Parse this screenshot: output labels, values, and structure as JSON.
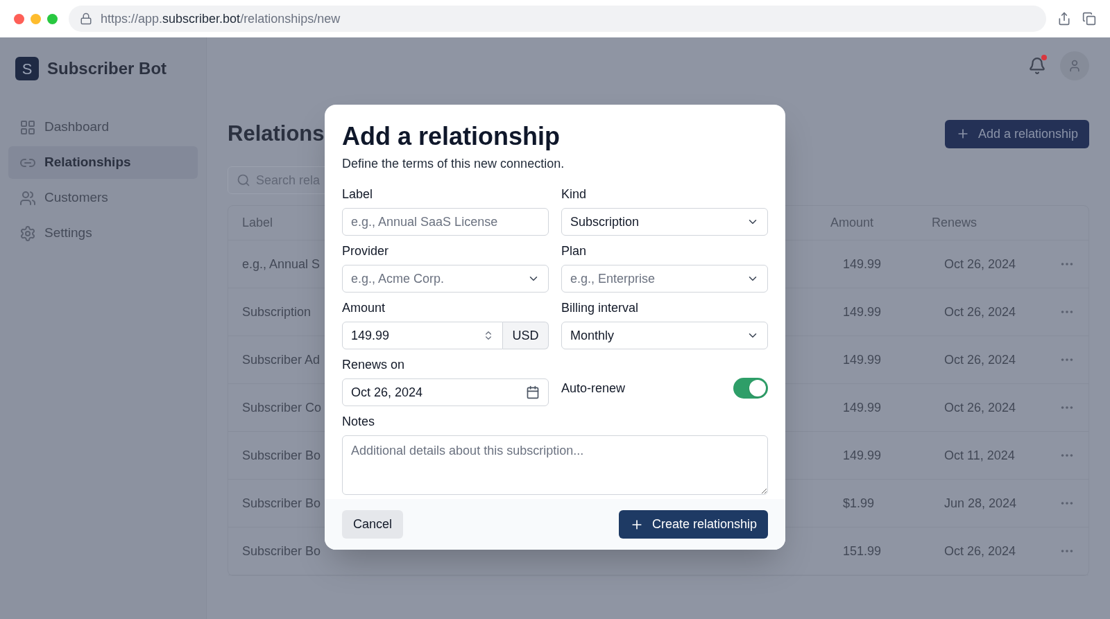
{
  "browser": {
    "url": [
      {
        "text": "https://app.",
        "strong": false
      },
      {
        "text": "subscriber.bot",
        "strong": true
      },
      {
        "text": "/relationships/new",
        "strong": false
      }
    ]
  },
  "app": {
    "logo_letter": "S",
    "name": "Subscriber Bot"
  },
  "sidebar": {
    "items": [
      {
        "label": "Dashboard",
        "selected": false
      },
      {
        "label": "Relationships",
        "selected": true
      },
      {
        "label": "Customers",
        "selected": false
      },
      {
        "label": "Settings",
        "selected": false
      }
    ]
  },
  "header": {
    "notification_unread": true
  },
  "page": {
    "title": "Relations",
    "add_button": "Add a relationship",
    "search": {
      "placeholder": "Search rela"
    }
  },
  "table": {
    "columns": {
      "label": "Label",
      "amount": "Amount",
      "renews": "Renews"
    },
    "rows": [
      {
        "label": "e.g., Annual S",
        "amount": "149.99",
        "renews": "Oct 26, 2024"
      },
      {
        "label": "Subscription",
        "amount": "149.99",
        "renews": "Oct 26, 2024"
      },
      {
        "label": "Subscriber Ad",
        "amount": "149.99",
        "renews": "Oct 26, 2024"
      },
      {
        "label": "Subscriber Co",
        "amount": "149.99",
        "renews": "Oct 26, 2024"
      },
      {
        "label": "Subscriber Bo",
        "amount": "149.99",
        "renews": "Oct 11, 2024"
      },
      {
        "label": "Subscriber Bo",
        "amount": "$1.99",
        "renews": "Jun 28, 2024"
      },
      {
        "label": "Subscriber Bo",
        "amount": "151.99",
        "renews": "Oct 26, 2024"
      }
    ]
  },
  "dialog": {
    "title": "Add a relationship",
    "subtitle": "Define the terms of this new connection.",
    "fields": [
      {
        "kind": "text",
        "label": "Label",
        "placeholder": "e.g., Annual SaaS License"
      },
      {
        "kind": "select",
        "label": "Kind",
        "value": "Subscription"
      },
      {
        "kind": "select",
        "label": "Provider",
        "placeholder": "e.g., Acme Corp."
      },
      {
        "kind": "select",
        "label": "Plan",
        "placeholder": "e.g., Enterprise"
      },
      {
        "kind": "amount",
        "label": "Amount",
        "value": "149.99",
        "currency": "USD"
      },
      {
        "kind": "select",
        "label": "Billing interval",
        "value": "Monthly"
      },
      {
        "kind": "date",
        "label": "Renews on",
        "value": "Oct 26, 2024"
      },
      {
        "kind": "toggle",
        "label": "Auto-renew",
        "on": true
      },
      {
        "kind": "textarea",
        "label": "Notes",
        "placeholder": "Additional details about this subscription..."
      }
    ],
    "cancel": "Cancel",
    "submit": "Create relationship"
  }
}
